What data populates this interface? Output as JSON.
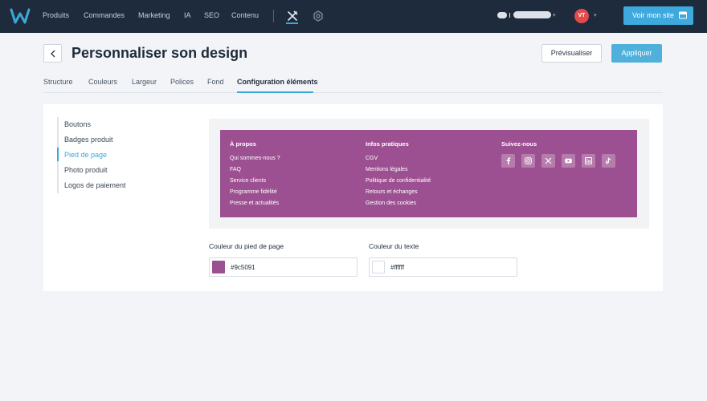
{
  "topnav": {
    "items": [
      "Produits",
      "Commandes",
      "Marketing",
      "IA",
      "SEO",
      "Contenu"
    ],
    "avatar_initials": "VT",
    "visit_button": "Voir mon site"
  },
  "header": {
    "title": "Personnaliser son design",
    "preview_button": "Prévisualiser",
    "apply_button": "Appliquer"
  },
  "tabs": [
    "Structure",
    "Couleurs",
    "Largeur",
    "Polices",
    "Fond",
    "Configuration éléments"
  ],
  "active_tab": "Configuration éléments",
  "sidebar": {
    "items": [
      "Boutons",
      "Badges produit",
      "Pied de page",
      "Photo produit",
      "Logos de paiement"
    ],
    "active": "Pied de page"
  },
  "footer_preview": {
    "background": "#9c5091",
    "text_color": "#ffffff",
    "columns": [
      {
        "title": "À propos",
        "links": [
          "Qui sommes-nous ?",
          "FAQ",
          "Service clients",
          "Programme fidélité",
          "Presse et actualités"
        ]
      },
      {
        "title": "Infos pratiques",
        "links": [
          "CGV",
          "Mentions légales",
          "Politique de confidentialité",
          "Retours et échanges",
          "Gestion des cookies"
        ]
      }
    ],
    "social_title": "Suivez-nous",
    "social_icons": [
      "facebook-icon",
      "instagram-icon",
      "x-icon",
      "youtube-icon",
      "linkedin-icon",
      "tiktok-icon"
    ]
  },
  "fields": {
    "footer_color_label": "Couleur du pied de page",
    "footer_color_value": "#9c5091",
    "text_color_label": "Couleur du texte",
    "text_color_value": "#ffffff"
  },
  "colors": {
    "nav_bg": "#1e2b3d",
    "accent": "#3ba8d8"
  }
}
